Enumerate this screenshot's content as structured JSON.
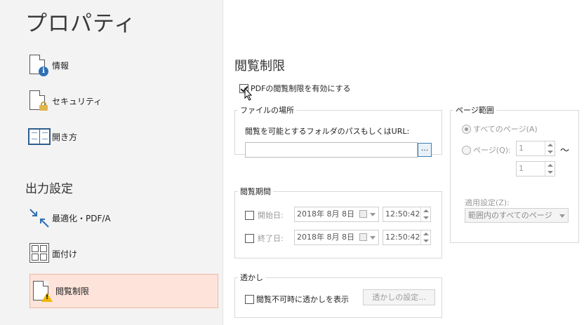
{
  "left": {
    "title": "プロパティ",
    "items": [
      {
        "label": "情報",
        "icon": "info-document-icon"
      },
      {
        "label": "セキュリティ",
        "icon": "lock-document-icon"
      },
      {
        "label": "開き方",
        "icon": "open-book-icon"
      }
    ],
    "output_section": "出力設定",
    "output_items": [
      {
        "label": "最適化・PDF/A",
        "icon": "optimize-arrows-icon"
      },
      {
        "label": "面付け",
        "icon": "imposition-grid-icon"
      },
      {
        "label": "閲覧制限",
        "icon": "warning-document-icon"
      }
    ]
  },
  "main": {
    "heading": "閲覧制限",
    "enable_label": "PDFの閲覧制限を有効にする",
    "enable_checked": true,
    "file_location": {
      "legend": "ファイルの場所",
      "label": "閲覧を可能とするフォルダのパスもしくはURL:",
      "value": "",
      "browse_label": "..."
    },
    "period": {
      "legend": "閲覧期間",
      "start_label": "開始日:",
      "start_date": "2018年  8月  8日",
      "start_time": "12:50:42",
      "end_label": "終了日:",
      "end_date": "2018年  8月  8日",
      "end_time": "12:50:42"
    },
    "watermark": {
      "legend": "透かし",
      "show_label": "閲覧不可時に透かしを表示",
      "settings_button": "透かしの設定..."
    },
    "page_range": {
      "legend": "ページ範囲",
      "all_pages": "すべてのページ(A)",
      "pages": "ページ(Q):",
      "from": "1",
      "to": "1",
      "tilde": "～",
      "apply_label": "適用設定(Z):",
      "apply_value": "範囲内のすべてのページ"
    }
  }
}
